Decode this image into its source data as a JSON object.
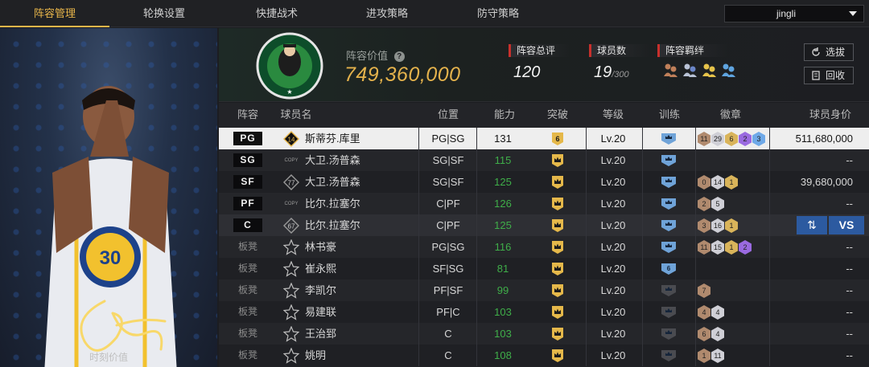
{
  "nav": {
    "tabs": [
      "阵容管理",
      "轮换设置",
      "快捷战术",
      "进攻策略",
      "防守策略"
    ],
    "active_index": 0,
    "account": "jingli"
  },
  "art": {
    "caption": "时刻价值"
  },
  "summary": {
    "value_label": "阵容价值",
    "value": "749,360,000",
    "rating_label": "阵容总评",
    "rating": "120",
    "count_label": "球员数",
    "count": "19",
    "count_max": "/300",
    "bond_label": "阵容羁绊",
    "select_btn": "选拔",
    "recycle_btn": "回收"
  },
  "table": {
    "headers": [
      "阵容",
      "球员名",
      "位置",
      "能力",
      "突破",
      "等级",
      "训练",
      "徽章",
      "球员身价"
    ],
    "rows": [
      {
        "slot": "PG",
        "starter": true,
        "num": "14",
        "name": "斯蒂芬.库里",
        "pos": "PG|SG",
        "ability": "131",
        "break": "6",
        "level": "Lv.20",
        "badges": [
          "11",
          "29",
          "6",
          "2",
          "3"
        ],
        "worth": "511,680,000",
        "style": "selected"
      },
      {
        "slot": "SG",
        "starter": true,
        "num": "COPY",
        "name": "大卫.汤普森",
        "pos": "SG|SF",
        "ability": "115",
        "break": "",
        "level": "Lv.20",
        "badges": [],
        "worth": "--",
        "style": "odd"
      },
      {
        "slot": "SF",
        "starter": true,
        "num": "77",
        "name": "大卫.汤普森",
        "pos": "SG|SF",
        "ability": "125",
        "break": "",
        "level": "Lv.20",
        "badges": [
          "0",
          "14",
          "1"
        ],
        "worth": "39,680,000",
        "style": "even"
      },
      {
        "slot": "PF",
        "starter": true,
        "num": "COPY",
        "name": "比尔.拉塞尔",
        "pos": "C|PF",
        "ability": "126",
        "break": "",
        "level": "Lv.20",
        "badges": [
          "2",
          "5"
        ],
        "worth": "--",
        "style": "odd"
      },
      {
        "slot": "C",
        "starter": true,
        "num": "67",
        "name": "比尔.拉塞尔",
        "pos": "C|PF",
        "ability": "125",
        "break": "",
        "level": "Lv.20",
        "badges": [
          "3",
          "16",
          "1"
        ],
        "worth": "",
        "style": "highlight"
      },
      {
        "slot": "板凳",
        "starter": false,
        "num": "",
        "name": "林书豪",
        "pos": "PG|SG",
        "ability": "116",
        "break": "",
        "level": "Lv.20",
        "badges": [
          "11",
          "15",
          "1",
          "2"
        ],
        "worth": "--",
        "style": "odd"
      },
      {
        "slot": "板凳",
        "starter": false,
        "num": "",
        "name": "崔永熙",
        "pos": "SF|SG",
        "ability": "81",
        "break": "",
        "level": "Lv.20",
        "badges": [],
        "worth": "--",
        "style": "even",
        "train": "6"
      },
      {
        "slot": "板凳",
        "starter": false,
        "num": "",
        "name": "李凯尔",
        "pos": "PF|SF",
        "ability": "99",
        "break": "",
        "level": "Lv.20",
        "badges": [
          "7"
        ],
        "worth": "--",
        "style": "odd"
      },
      {
        "slot": "板凳",
        "starter": false,
        "num": "",
        "name": "易建联",
        "pos": "PF|C",
        "ability": "103",
        "break": "",
        "level": "Lv.20",
        "badges": [
          "4",
          "4"
        ],
        "worth": "--",
        "style": "even"
      },
      {
        "slot": "板凳",
        "starter": false,
        "num": "",
        "name": "王治郅",
        "pos": "C",
        "ability": "103",
        "break": "",
        "level": "Lv.20",
        "badges": [
          "6",
          "4"
        ],
        "worth": "--",
        "style": "odd"
      },
      {
        "slot": "板凳",
        "starter": false,
        "num": "",
        "name": "姚明",
        "pos": "C",
        "ability": "108",
        "break": "",
        "level": "Lv.20",
        "badges": [
          "1",
          "11"
        ],
        "worth": "--",
        "style": "even"
      }
    ],
    "vs_label": "VS"
  },
  "colors": {
    "accent": "#e9b64a",
    "value_gold": "#e4b24c",
    "ability_green": "#3fae49",
    "action_blue": "#2c5aa0"
  }
}
